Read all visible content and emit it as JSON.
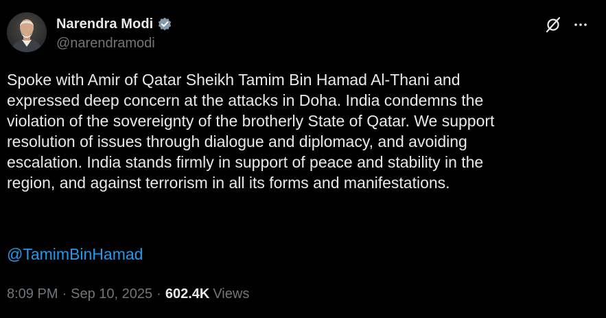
{
  "author": {
    "display_name": "Narendra Modi",
    "handle": "@narendramodi"
  },
  "icons": {
    "verified": "verified-badge-icon",
    "grok": "grok-icon",
    "more": "more-icon"
  },
  "colors": {
    "background": "#000000",
    "text": "#e7e9ea",
    "muted": "#71767b",
    "link": "#1d9bf0"
  },
  "tweet": {
    "text": "Spoke with Amir of Qatar Sheikh Tamim Bin Hamad Al-Thani and\nexpressed deep concern at the attacks in Doha. India condemns the\nviolation of the sovereignty of the brotherly State of Qatar. We support\nresolution of issues through dialogue and diplomacy, and avoiding\nescalation. India stands firmly in support of peace and stability in the\nregion, and against terrorism in all its forms and manifestations.",
    "mention": "@TamimBinHamad",
    "time": "8:09 PM",
    "separator": "·",
    "date": "Sep 10, 2025",
    "views_count": "602.4K",
    "views_label": "Views"
  }
}
